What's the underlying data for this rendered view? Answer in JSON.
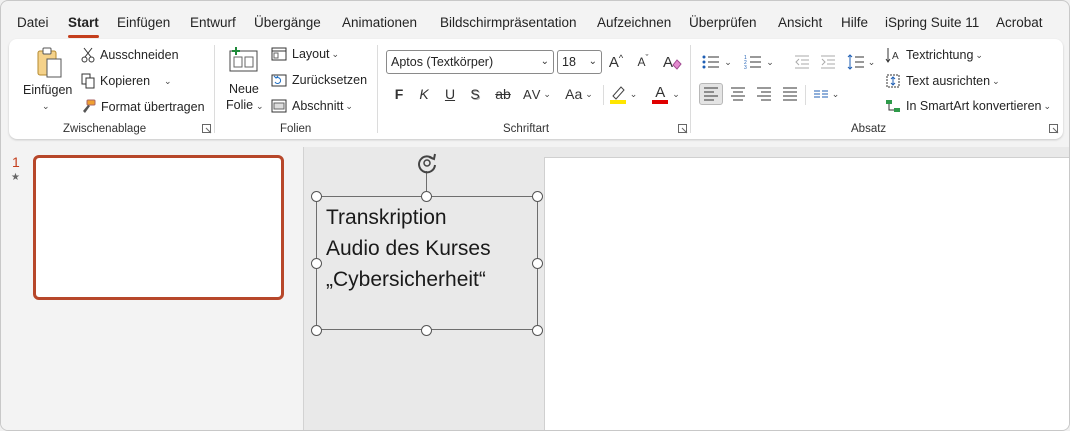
{
  "tabs": [
    "Datei",
    "Start",
    "Einfügen",
    "Entwurf",
    "Übergänge",
    "Animationen",
    "Bildschirmpräsentation",
    "Aufzeichnen",
    "Überprüfen",
    "Ansicht",
    "Hilfe",
    "iSpring Suite 11",
    "Acrobat"
  ],
  "active_tab": "Start",
  "clipboard": {
    "paste": "Einfügen",
    "cut": "Ausschneiden",
    "copy": "Kopieren",
    "format_painter": "Format übertragen",
    "group": "Zwischenablage"
  },
  "slides": {
    "new_slide_line1": "Neue",
    "new_slide_line2": "Folie",
    "layout": "Layout",
    "reset": "Zurücksetzen",
    "section": "Abschnitt",
    "group": "Folien"
  },
  "font": {
    "family": "Aptos (Textkörper)",
    "size": "18",
    "bold": "F",
    "italic": "K",
    "underline": "U",
    "shadow": "S",
    "strike": "ab",
    "spacing": "AV",
    "case": "Aa",
    "grow": "A",
    "shrink": "A",
    "font_color_letter": "A",
    "group": "Schriftart"
  },
  "paragraph": {
    "text_direction": "Textrichtung",
    "align_text": "Text ausrichten",
    "smartart": "In SmartArt konvertieren",
    "group": "Absatz"
  },
  "thumbnail": {
    "number": "1",
    "star": "★"
  },
  "textbox": {
    "lines": [
      "Transkription",
      "Audio des Kurses",
      "„Cybersicherheit“"
    ]
  },
  "colors": {
    "accent": "#c43e1c",
    "highlight": "#ffe600",
    "font_color": "#e00000",
    "thumb_border": "#b7472a"
  }
}
